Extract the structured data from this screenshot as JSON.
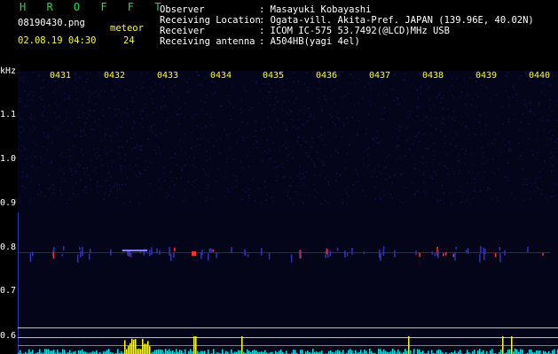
{
  "header": {
    "app_name": "H R O F F T",
    "filename": "08190430.png",
    "datetime": "02.08.19 04:30",
    "meteor_label": "meteor",
    "meteor_count": "24",
    "fields": [
      {
        "label": "Observer",
        "value": ": Masayuki Kobayashi"
      },
      {
        "label": "Receiving Location",
        "value": ": Ogata-vill. Akita-Pref. JAPAN (139.96E, 40.02N)"
      },
      {
        "label": "Receiver",
        "value": ": ICOM IC-575 53.7492(@LCD)MHz USB"
      },
      {
        "label": "Receiving antenna",
        "value": ": A504HB(yagi 4el)"
      }
    ]
  },
  "axis": {
    "unit": "kHz",
    "y_ticks": [
      "1.1",
      "1.0",
      "0.9",
      "0.8",
      "0.7",
      "0.6"
    ],
    "time_ticks": [
      "0431",
      "0432",
      "0433",
      "0434",
      "0435",
      "0436",
      "0437",
      "0438",
      "0439",
      "0440"
    ]
  },
  "colors": {
    "background": "#000000",
    "noise": "#10105a",
    "carrier": "#3030c0",
    "signal_red": "#ff3030",
    "histogram_cyan": "#00e0e0",
    "histogram_yellow": "#ffff00",
    "frame_line": "#c0c0c0"
  }
}
